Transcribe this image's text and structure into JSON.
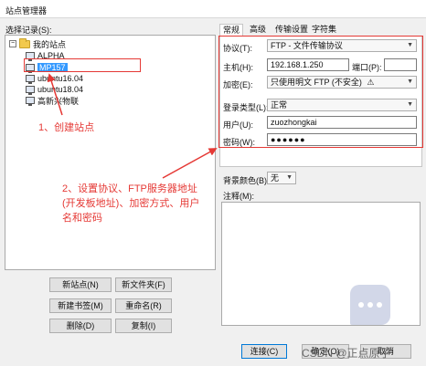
{
  "window": {
    "title": "站点管理器"
  },
  "left": {
    "select_label": "选择记录(S):",
    "tree": {
      "root": "我的站点",
      "items": [
        "ALPHA",
        "MP157",
        "ubuntu16.04",
        "ubuntu18.04",
        "高新兴物联"
      ],
      "selected": "MP157"
    },
    "buttons": {
      "new_site": "新站点(N)",
      "new_folder": "新文件夹(F)",
      "new_bookmark": "新建书签(M)",
      "rename": "重命名(R)",
      "delete": "删除(D)",
      "copy": "复制(I)"
    }
  },
  "tabs": [
    "常规",
    "高级",
    "传输设置",
    "字符集"
  ],
  "general": {
    "protocol_label": "协议(T):",
    "protocol_value": "FTP - 文件传输协议",
    "host_label": "主机(H):",
    "host_value": "192.168.1.250",
    "port_label": "端口(P):",
    "port_value": "",
    "encryption_label": "加密(E):",
    "encryption_value": "只使用明文 FTP (不安全)",
    "logon_type_label": "登录类型(L):",
    "logon_type_value": "正常",
    "user_label": "用户(U):",
    "user_value": "zuozhongkai",
    "password_label": "密码(W):",
    "password_value": "●●●●●●"
  },
  "extra": {
    "bg_color_label": "背景颜色(B)",
    "bg_color_value": "无",
    "notes_label": "注释(M):"
  },
  "bottom_buttons": {
    "connect": "连接(C)",
    "ok": "确定(O)",
    "cancel": "取消"
  },
  "annotations": {
    "step1": "1、创建站点",
    "step2_line1": "2、设置协议、FTP服务器地址",
    "step2_line2": "(开发板地址)、加密方式、用户",
    "step2_line3": "名和密码"
  },
  "watermark": "CSDN @正点原子",
  "colors": {
    "annotation": "#e53935",
    "selection": "#3399ff",
    "focus": "#0078d7"
  }
}
